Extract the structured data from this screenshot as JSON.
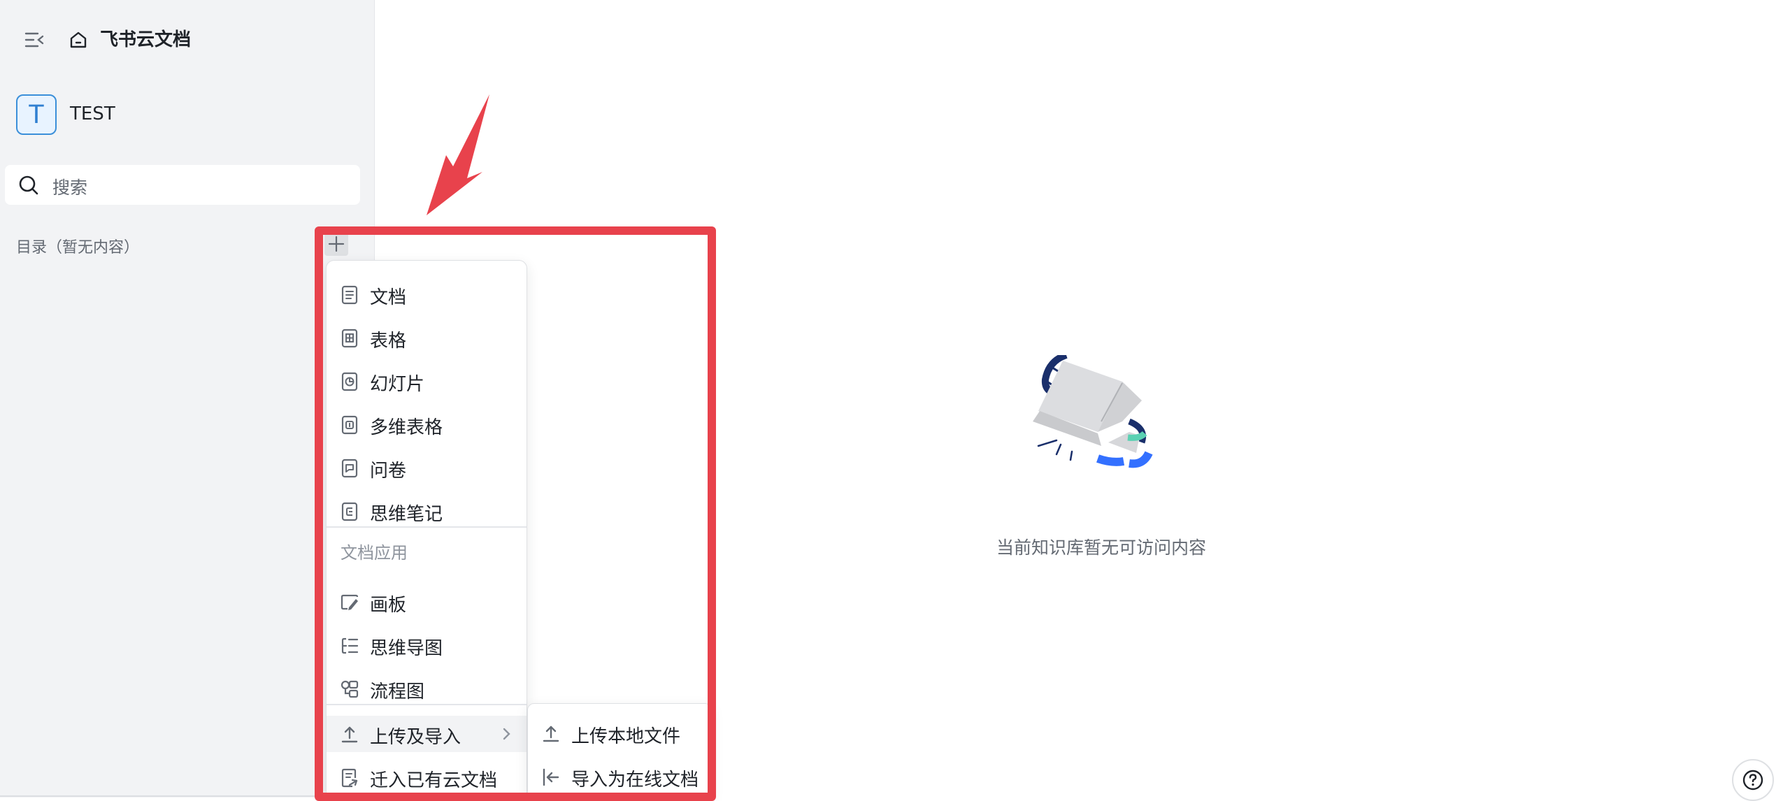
{
  "app": {
    "title": "飞书云文档"
  },
  "space": {
    "avatar_letter": "T",
    "name": "TEST"
  },
  "search": {
    "placeholder": "搜索"
  },
  "toc": {
    "label": "目录（暂无内容）"
  },
  "create_menu": {
    "items": [
      {
        "label": "文档",
        "icon": "doc-icon"
      },
      {
        "label": "表格",
        "icon": "sheet-icon"
      },
      {
        "label": "幻灯片",
        "icon": "slides-icon"
      },
      {
        "label": "多维表格",
        "icon": "bitable-icon"
      },
      {
        "label": "问卷",
        "icon": "form-icon"
      },
      {
        "label": "思维笔记",
        "icon": "mindnote-icon"
      }
    ],
    "group_label": "文档应用",
    "app_items": [
      {
        "label": "画板",
        "icon": "whiteboard-icon"
      },
      {
        "label": "思维导图",
        "icon": "mindmap-icon"
      },
      {
        "label": "流程图",
        "icon": "flowchart-icon"
      }
    ],
    "upload_label": "上传及导入",
    "migrate_label": "迁入已有云文档"
  },
  "upload_submenu": {
    "items": [
      {
        "label": "上传本地文件",
        "icon": "upload-icon"
      },
      {
        "label": "导入为在线文档",
        "icon": "import-icon"
      }
    ]
  },
  "empty_state": {
    "text": "当前知识库暂无可访问内容"
  },
  "colors": {
    "highlight": "#e8424c",
    "accent": "#3370ff",
    "sidebar_bg": "#f2f3f5"
  }
}
